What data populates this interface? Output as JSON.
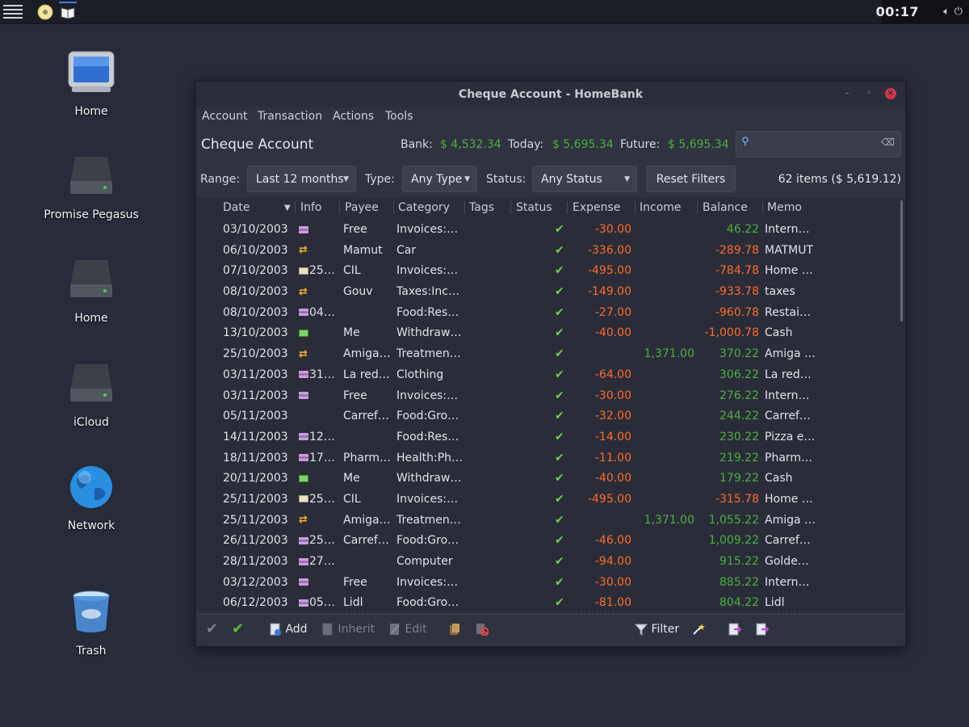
{
  "panel": {
    "clock": "00:17"
  },
  "desktop": {
    "icons": [
      {
        "label": "Home"
      },
      {
        "label": "Promise Pegasus"
      },
      {
        "label": "Home"
      },
      {
        "label": "iCloud"
      },
      {
        "label": "Network"
      },
      {
        "label": "Trash"
      }
    ]
  },
  "window": {
    "title": "Cheque Account - HomeBank",
    "menu": [
      "Account",
      "Transaction",
      "Actions",
      "Tools"
    ],
    "account_name": "Cheque Account",
    "balances": {
      "bank_label": "Bank:",
      "bank_value": "$ 4,532.34",
      "today_label": "Today:",
      "today_value": "$ 5,695.34",
      "future_label": "Future:",
      "future_value": "$ 5,695.34"
    },
    "filters": {
      "range_label": "Range:",
      "range_value": "Last 12 months",
      "type_label": "Type:",
      "type_value": "Any Type",
      "status_label": "Status:",
      "status_value": "Any Status",
      "reset_label": "Reset Filters",
      "items_count": "62 items ($ 5,619.12)"
    },
    "columns": [
      "Date",
      "Info",
      "Payee",
      "Category",
      "Tags",
      "Status",
      "Expense",
      "Income",
      "Balance",
      "Memo"
    ],
    "rows": [
      {
        "date": "03/10/2003",
        "icon": "card",
        "info": "",
        "payee": "Free",
        "category": "Invoices:…",
        "expense": "-30.00",
        "income": "",
        "balance": "46.22",
        "bal_sign": "pos",
        "memo": "Intern…"
      },
      {
        "date": "06/10/2003",
        "icon": "transfer",
        "info": "",
        "payee": "Mamut",
        "category": "Car",
        "expense": "-336.00",
        "income": "",
        "balance": "-289.78",
        "bal_sign": "neg",
        "memo": "MATMUT"
      },
      {
        "date": "07/10/2003",
        "icon": "cheque",
        "info": "25…",
        "payee": "CIL",
        "category": "Invoices:…",
        "expense": "-495.00",
        "income": "",
        "balance": "-784.78",
        "bal_sign": "neg",
        "memo": "Home …"
      },
      {
        "date": "08/10/2003",
        "icon": "transfer",
        "info": "",
        "payee": "Gouv",
        "category": "Taxes:Inc…",
        "expense": "-149.00",
        "income": "",
        "balance": "-933.78",
        "bal_sign": "neg",
        "memo": "taxes"
      },
      {
        "date": "08/10/2003",
        "icon": "card",
        "info": "04…",
        "payee": "",
        "category": "Food:Res…",
        "expense": "-27.00",
        "income": "",
        "balance": "-960.78",
        "bal_sign": "neg",
        "memo": "Restai…"
      },
      {
        "date": "13/10/2003",
        "icon": "cash",
        "info": "",
        "payee": "Me",
        "category": "Withdraw…",
        "expense": "-40.00",
        "income": "",
        "balance": "-1,000.78",
        "bal_sign": "neg",
        "memo": "Cash"
      },
      {
        "date": "25/10/2003",
        "icon": "transfer",
        "info": "",
        "payee": "Amiga…",
        "category": "Treatmen…",
        "expense": "",
        "income": "1,371.00",
        "balance": "370.22",
        "bal_sign": "pos",
        "memo": "Amiga …"
      },
      {
        "date": "03/11/2003",
        "icon": "card",
        "info": "31…",
        "payee": "La red…",
        "category": "Clothing",
        "expense": "-64.00",
        "income": "",
        "balance": "306.22",
        "bal_sign": "pos",
        "memo": "La red…"
      },
      {
        "date": "03/11/2003",
        "icon": "card",
        "info": "",
        "payee": "Free",
        "category": "Invoices:…",
        "expense": "-30.00",
        "income": "",
        "balance": "276.22",
        "bal_sign": "pos",
        "memo": "Intern…"
      },
      {
        "date": "05/11/2003",
        "icon": "none",
        "info": "",
        "payee": "Carref…",
        "category": "Food:Gro…",
        "expense": "-32.00",
        "income": "",
        "balance": "244.22",
        "bal_sign": "pos",
        "memo": "Carref…"
      },
      {
        "date": "14/11/2003",
        "icon": "card",
        "info": "12…",
        "payee": "",
        "category": "Food:Res…",
        "expense": "-14.00",
        "income": "",
        "balance": "230.22",
        "bal_sign": "pos",
        "memo": "Pizza e…"
      },
      {
        "date": "18/11/2003",
        "icon": "card",
        "info": "17…",
        "payee": "Pharm…",
        "category": "Health:Ph…",
        "expense": "-11.00",
        "income": "",
        "balance": "219.22",
        "bal_sign": "pos",
        "memo": "Pharm…"
      },
      {
        "date": "20/11/2003",
        "icon": "cash",
        "info": "",
        "payee": "Me",
        "category": "Withdraw…",
        "expense": "-40.00",
        "income": "",
        "balance": "179.22",
        "bal_sign": "pos",
        "memo": "Cash"
      },
      {
        "date": "25/11/2003",
        "icon": "cheque",
        "info": "25…",
        "payee": "CIL",
        "category": "Invoices:…",
        "expense": "-495.00",
        "income": "",
        "balance": "-315.78",
        "bal_sign": "neg",
        "memo": "Home …"
      },
      {
        "date": "25/11/2003",
        "icon": "transfer",
        "info": "",
        "payee": "Amiga…",
        "category": "Treatmen…",
        "expense": "",
        "income": "1,371.00",
        "balance": "1,055.22",
        "bal_sign": "pos",
        "memo": "Amiga …"
      },
      {
        "date": "26/11/2003",
        "icon": "card",
        "info": "25…",
        "payee": "Carref…",
        "category": "Food:Gro…",
        "expense": "-46.00",
        "income": "",
        "balance": "1,009.22",
        "bal_sign": "pos",
        "memo": "Carref…"
      },
      {
        "date": "28/11/2003",
        "icon": "card",
        "info": "27…",
        "payee": "",
        "category": "Computer",
        "expense": "-94.00",
        "income": "",
        "balance": "915.22",
        "bal_sign": "pos",
        "memo": "Golde…"
      },
      {
        "date": "03/12/2003",
        "icon": "card",
        "info": "",
        "payee": "Free",
        "category": "Invoices:…",
        "expense": "-30.00",
        "income": "",
        "balance": "885.22",
        "bal_sign": "pos",
        "memo": "Intern…"
      },
      {
        "date": "06/12/2003",
        "icon": "card",
        "info": "05…",
        "payee": "Lidl",
        "category": "Food:Gro…",
        "expense": "-81.00",
        "income": "",
        "balance": "804.22",
        "bal_sign": "pos",
        "memo": "Lidl"
      }
    ],
    "toolbar": {
      "add": "Add",
      "inherit": "Inherit",
      "edit": "Edit",
      "filter": "Filter"
    }
  },
  "colors": {
    "income": "#4caf3f",
    "expense": "#ff6a2a",
    "check": "#6fd04a",
    "close": "#d1344a"
  }
}
